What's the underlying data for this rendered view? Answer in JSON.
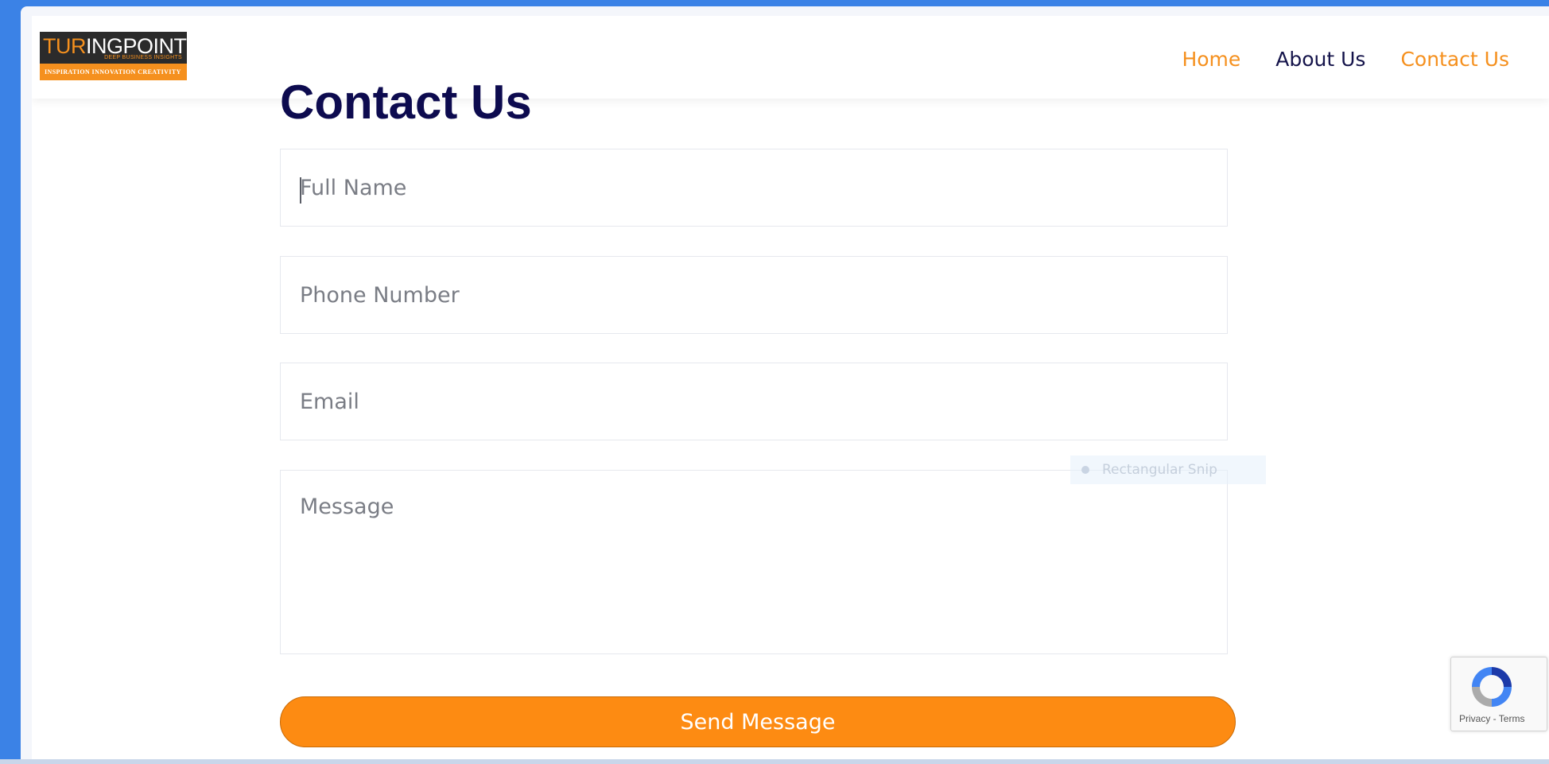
{
  "logo": {
    "word_orange": "TUR",
    "word_white": "INGPOINT",
    "subtitle": "DEEP BUSINESS INSIGHTS",
    "tagline": "INSPIRATION  INNOVATION  CREATIVITY"
  },
  "nav": {
    "items": [
      {
        "label": "Home"
      },
      {
        "label": "About Us"
      },
      {
        "label": "Contact Us"
      }
    ]
  },
  "page": {
    "title": "Contact Us"
  },
  "form": {
    "full_name_placeholder": "Full Name",
    "phone_placeholder": "Phone Number",
    "email_placeholder": "Email",
    "message_placeholder": "Message",
    "submit_label": "Send Message"
  },
  "overlay": {
    "snip_label": "Rectangular Snip"
  },
  "recaptcha": {
    "terms": "Privacy - Terms"
  },
  "colors": {
    "accent_orange": "#fd8b12",
    "title_navy": "#0d0b4f",
    "desktop_blue": "#3b82e6"
  }
}
